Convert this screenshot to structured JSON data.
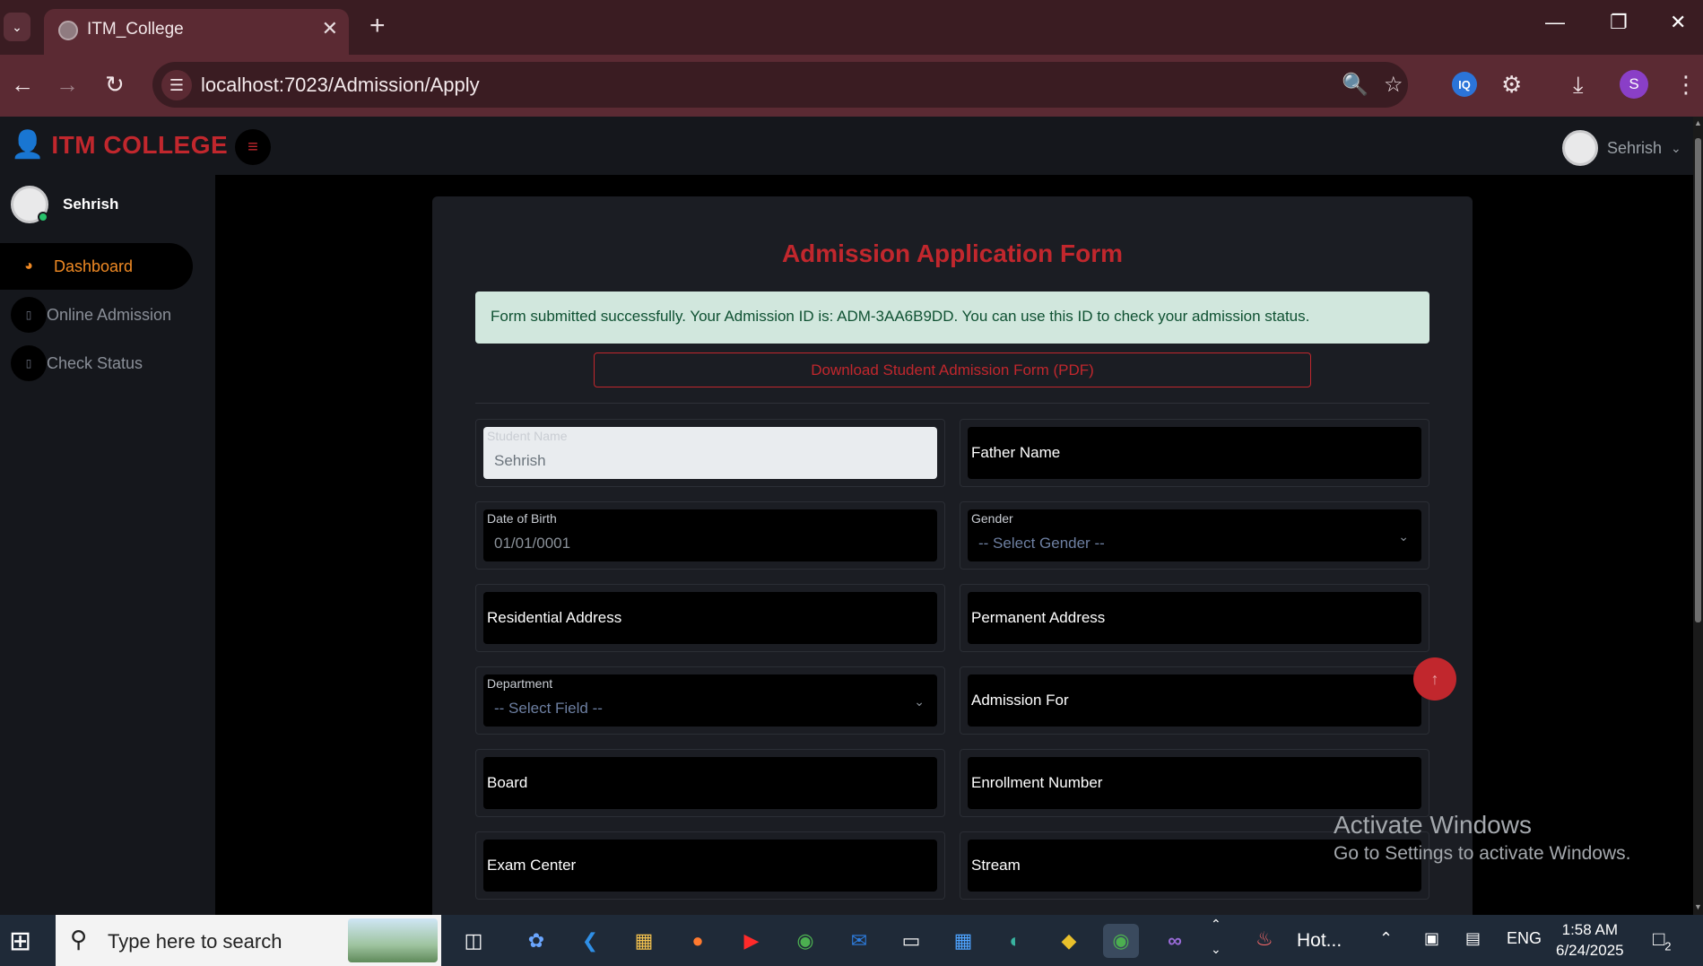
{
  "browser": {
    "tab_title": "ITM_College",
    "url": "localhost:7023/Admission/Apply",
    "profile_initial": "S",
    "ext_label": "IQ"
  },
  "app": {
    "brand": "ITM COLLEGE",
    "accent": "#c1272d",
    "top_user": "Sehrish"
  },
  "sidebar": {
    "user_name": "Sehrish",
    "items": [
      {
        "label": "Dashboard",
        "icon": "dashboard-gauge-icon",
        "active": true
      },
      {
        "label": "Online Admission",
        "icon": "form-icon",
        "active": false
      },
      {
        "label": "Check Status",
        "icon": "status-icon",
        "active": false
      }
    ]
  },
  "form": {
    "title": "Admission Application Form",
    "alert": "Form submitted successfully. Your Admission ID is: ADM-3AA6B9DD. You can use this ID to check your admission status.",
    "download_label": "Download Student Admission Form (PDF)",
    "fields": {
      "student_name": {
        "label": "Student Name",
        "value": "Sehrish"
      },
      "father_name": {
        "label": "Father Name"
      },
      "dob": {
        "label": "Date of Birth",
        "value": "01/01/0001"
      },
      "gender": {
        "label": "Gender",
        "value": "-- Select Gender --"
      },
      "residential_address": {
        "label": "Residential Address"
      },
      "permanent_address": {
        "label": "Permanent Address"
      },
      "department": {
        "label": "Department",
        "value": "-- Select Field --"
      },
      "admission_for": {
        "label": "Admission For"
      },
      "board": {
        "label": "Board"
      },
      "enrollment_number": {
        "label": "Enrollment Number"
      },
      "exam_center": {
        "label": "Exam Center"
      },
      "stream": {
        "label": "Stream"
      }
    }
  },
  "watermark": {
    "line1": "Activate Windows",
    "line2": "Go to Settings to activate Windows."
  },
  "taskbar": {
    "search_placeholder": "Type here to search",
    "weather_label": "Hot...",
    "lang": "ENG",
    "time": "1:58 AM",
    "date": "6/24/2025",
    "notification_count": "2"
  }
}
